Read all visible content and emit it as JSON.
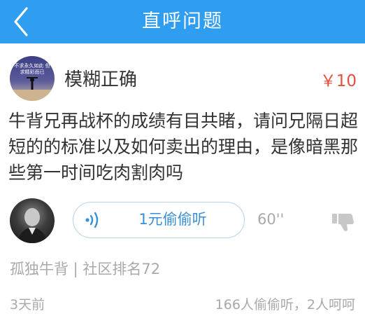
{
  "header": {
    "title": "直呼问题"
  },
  "question": {
    "asker_name": "模糊正确",
    "avatar_text": "不求永久如此 但求精彩而已",
    "price": "￥10",
    "text": "牛背兄再战杯的成绩有目共睹，请问兄隔日超短的的标准以及如何卖出的理由，是像暗黑那些第一时间吃肉割肉吗"
  },
  "answer": {
    "listen_label": "1元偷偷听",
    "duration": "60''",
    "answerer_info": "孤独牛背 | 社区排名72",
    "posted_time": "3天前",
    "stats": "166人偷偷听，2人呵呵"
  },
  "colors": {
    "header_bg": "#2f9df0",
    "price": "#e8503a",
    "listen_text": "#3a8fd4"
  },
  "icons": {
    "back": "chevron-left-icon",
    "sound": "sound-wave-icon",
    "dislike": "thumbs-down-icon"
  }
}
